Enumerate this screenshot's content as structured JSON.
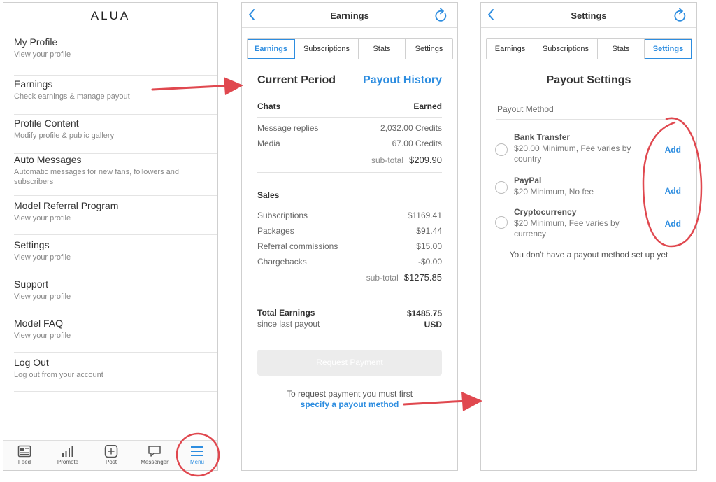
{
  "menu_screen": {
    "logo": "ALUA",
    "items": [
      {
        "title": "My Profile",
        "subtitle": "View your profile"
      },
      {
        "title": "Earnings",
        "subtitle": "Check earnings & manage payout"
      },
      {
        "title": "Profile Content",
        "subtitle": "Modify  profile & public gallery"
      },
      {
        "title": "Auto Messages",
        "subtitle": "Automatic messages for new fans, followers and subscribers"
      },
      {
        "title": "Model Referral Program",
        "subtitle": "View your profile"
      },
      {
        "title": "Settings",
        "subtitle": "View your profile"
      },
      {
        "title": "Support",
        "subtitle": "View your profile"
      },
      {
        "title": "Model FAQ",
        "subtitle": "View your profile"
      },
      {
        "title": "Log Out",
        "subtitle": "Log out from your account"
      }
    ],
    "tabbar": [
      {
        "label": "Feed",
        "icon": "feed-icon"
      },
      {
        "label": "Promote",
        "icon": "promote-icon"
      },
      {
        "label": "Post",
        "icon": "post-icon"
      },
      {
        "label": "Messenger",
        "icon": "messenger-icon"
      },
      {
        "label": "Menu",
        "icon": "menu-icon",
        "active": true
      }
    ]
  },
  "earnings_screen": {
    "title": "Earnings",
    "tabs": [
      {
        "label": "Earnings",
        "active": true
      },
      {
        "label": "Subscriptions"
      },
      {
        "label": "Stats"
      },
      {
        "label": "Settings"
      }
    ],
    "current_period": "Current Period",
    "payout_history": "Payout History",
    "chats": {
      "header_left": "Chats",
      "header_right": "Earned",
      "rows": [
        {
          "label": "Message replies",
          "value": "2,032.00 Credits"
        },
        {
          "label": "Media",
          "value": "67.00 Credits"
        }
      ],
      "subtotal_label": "sub-total",
      "subtotal_value": "$209.90"
    },
    "sales": {
      "header": "Sales",
      "rows": [
        {
          "label": "Subscriptions",
          "value": "$1169.41"
        },
        {
          "label": "Packages",
          "value": "$91.44"
        },
        {
          "label": "Referral commissions",
          "value": "$15.00"
        },
        {
          "label": "Chargebacks",
          "value": "-$0.00"
        }
      ],
      "subtotal_label": "sub-total",
      "subtotal_value": "$1275.85"
    },
    "total": {
      "label": "Total Earnings",
      "sublabel": "since last payout",
      "value": "$1485.75",
      "currency": "USD"
    },
    "request_button": "Request Payment",
    "request_note": "To request payment you must first",
    "request_link": "specify a payout method"
  },
  "settings_screen": {
    "title": "Settings",
    "tabs": [
      {
        "label": "Earnings"
      },
      {
        "label": "Subscriptions"
      },
      {
        "label": "Stats"
      },
      {
        "label": "Settings",
        "active": true
      }
    ],
    "section_title": "Payout Settings",
    "payout_method_label": "Payout Method",
    "options": [
      {
        "name": "Bank Transfer",
        "description": "$20.00 Minimum, Fee varies by country",
        "action": "Add"
      },
      {
        "name": "PayPal",
        "description": "$20 Minimum, No fee",
        "action": "Add"
      },
      {
        "name": "Cryptocurrency",
        "description": "$20 Minimum, Fee varies by currency",
        "action": "Add"
      }
    ],
    "empty_note": "You don't have a payout method set up yet"
  },
  "colors": {
    "accent": "#2d8de0",
    "annotation": "#e0484f",
    "text": "#333333",
    "muted": "#888888",
    "border": "#dedede"
  }
}
